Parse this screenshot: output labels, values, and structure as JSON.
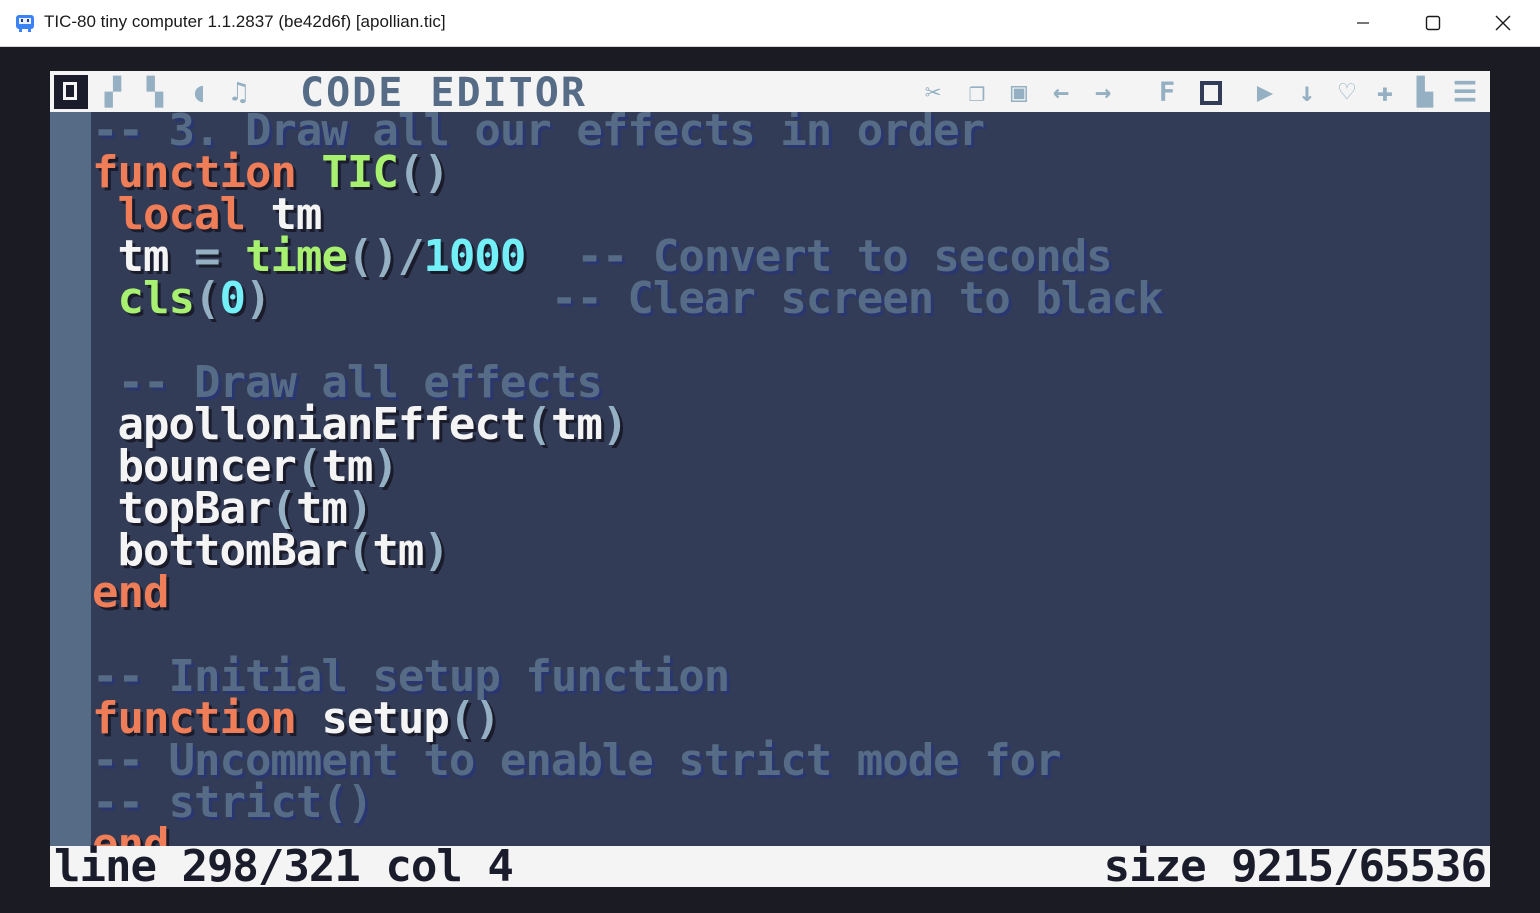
{
  "window": {
    "title": "TIC-80 tiny computer 1.1.2837 (be42d6f) [apollian.tic]",
    "app_icon": "tic80-robot-icon",
    "controls": [
      "minimize-icon",
      "maximize-icon",
      "close-icon"
    ]
  },
  "editor": {
    "mode_title": "CODE EDITOR",
    "tab_icons": [
      "code-tab-icon",
      "sprite-tab-icon",
      "map-tab-icon",
      "sfx-tab-icon",
      "music-tab-icon"
    ],
    "tool_icons": [
      "cut-icon",
      "copy-icon",
      "paste-icon",
      "undo-icon",
      "redo-icon",
      "find-icon",
      "outline-icon",
      "run-icon",
      "goto-icon",
      "bookmark-icon",
      "add-icon",
      "mark-icon",
      "menu-icon"
    ],
    "colors": {
      "background": "#333c57",
      "keyword": "#ef7d57",
      "function": "#a7f070",
      "identifier": "#f4f4f4",
      "punctuation": "#94b0c2",
      "number": "#73eff7",
      "comment": "#566c86"
    },
    "code_lines": [
      [
        {
          "t": "-- 3. Draw all our effects in order",
          "c": "cm"
        }
      ],
      [
        {
          "t": "function",
          "c": "kw"
        },
        {
          "t": " ",
          "c": "id"
        },
        {
          "t": "TIC",
          "c": "fn"
        },
        {
          "t": "()",
          "c": "pn"
        }
      ],
      [
        {
          "t": " ",
          "c": "id"
        },
        {
          "t": "local",
          "c": "kw"
        },
        {
          "t": " tm",
          "c": "id"
        }
      ],
      [
        {
          "t": " tm ",
          "c": "id"
        },
        {
          "t": "=",
          "c": "pn"
        },
        {
          "t": " ",
          "c": "id"
        },
        {
          "t": "time",
          "c": "fn"
        },
        {
          "t": "()/",
          "c": "pn"
        },
        {
          "t": "1000",
          "c": "nm"
        },
        {
          "t": "  ",
          "c": "id"
        },
        {
          "t": "-- Convert to seconds",
          "c": "cm"
        }
      ],
      [
        {
          "t": " ",
          "c": "id"
        },
        {
          "t": "cls",
          "c": "fn"
        },
        {
          "t": "(",
          "c": "pn"
        },
        {
          "t": "0",
          "c": "nm"
        },
        {
          "t": ")",
          "c": "pn"
        },
        {
          "t": "           ",
          "c": "id"
        },
        {
          "t": "-- Clear screen to black",
          "c": "cm"
        }
      ],
      [],
      [
        {
          "t": " -- Draw all effects",
          "c": "cm"
        }
      ],
      [
        {
          "t": " apollonianEffect",
          "c": "id"
        },
        {
          "t": "(",
          "c": "pn"
        },
        {
          "t": "tm",
          "c": "id"
        },
        {
          "t": ")",
          "c": "pn"
        }
      ],
      [
        {
          "t": " bouncer",
          "c": "id"
        },
        {
          "t": "(",
          "c": "pn"
        },
        {
          "t": "tm",
          "c": "id"
        },
        {
          "t": ")",
          "c": "pn"
        }
      ],
      [
        {
          "t": " topBar",
          "c": "id"
        },
        {
          "t": "(",
          "c": "pn"
        },
        {
          "t": "tm",
          "c": "id"
        },
        {
          "t": ")",
          "c": "pn"
        }
      ],
      [
        {
          "t": " bottomBar",
          "c": "id"
        },
        {
          "t": "(",
          "c": "pn"
        },
        {
          "t": "tm",
          "c": "id"
        },
        {
          "t": ")",
          "c": "pn"
        }
      ],
      [
        {
          "t": "end",
          "c": "kw"
        }
      ],
      [],
      [
        {
          "t": "-- Initial setup function",
          "c": "cm"
        }
      ],
      [
        {
          "t": "function",
          "c": "kw"
        },
        {
          "t": " setup",
          "c": "id"
        },
        {
          "t": "()",
          "c": "pn"
        }
      ],
      [
        {
          "t": "-- Uncomment to enable strict mode for",
          "c": "cm"
        }
      ],
      [
        {
          "t": "-- strict()",
          "c": "cm"
        }
      ],
      [
        {
          "t": "end",
          "c": "kw"
        }
      ]
    ]
  },
  "status": {
    "line_label": "line 298/321",
    "col_label": "col 4",
    "size_label": "size 9215/65536"
  }
}
